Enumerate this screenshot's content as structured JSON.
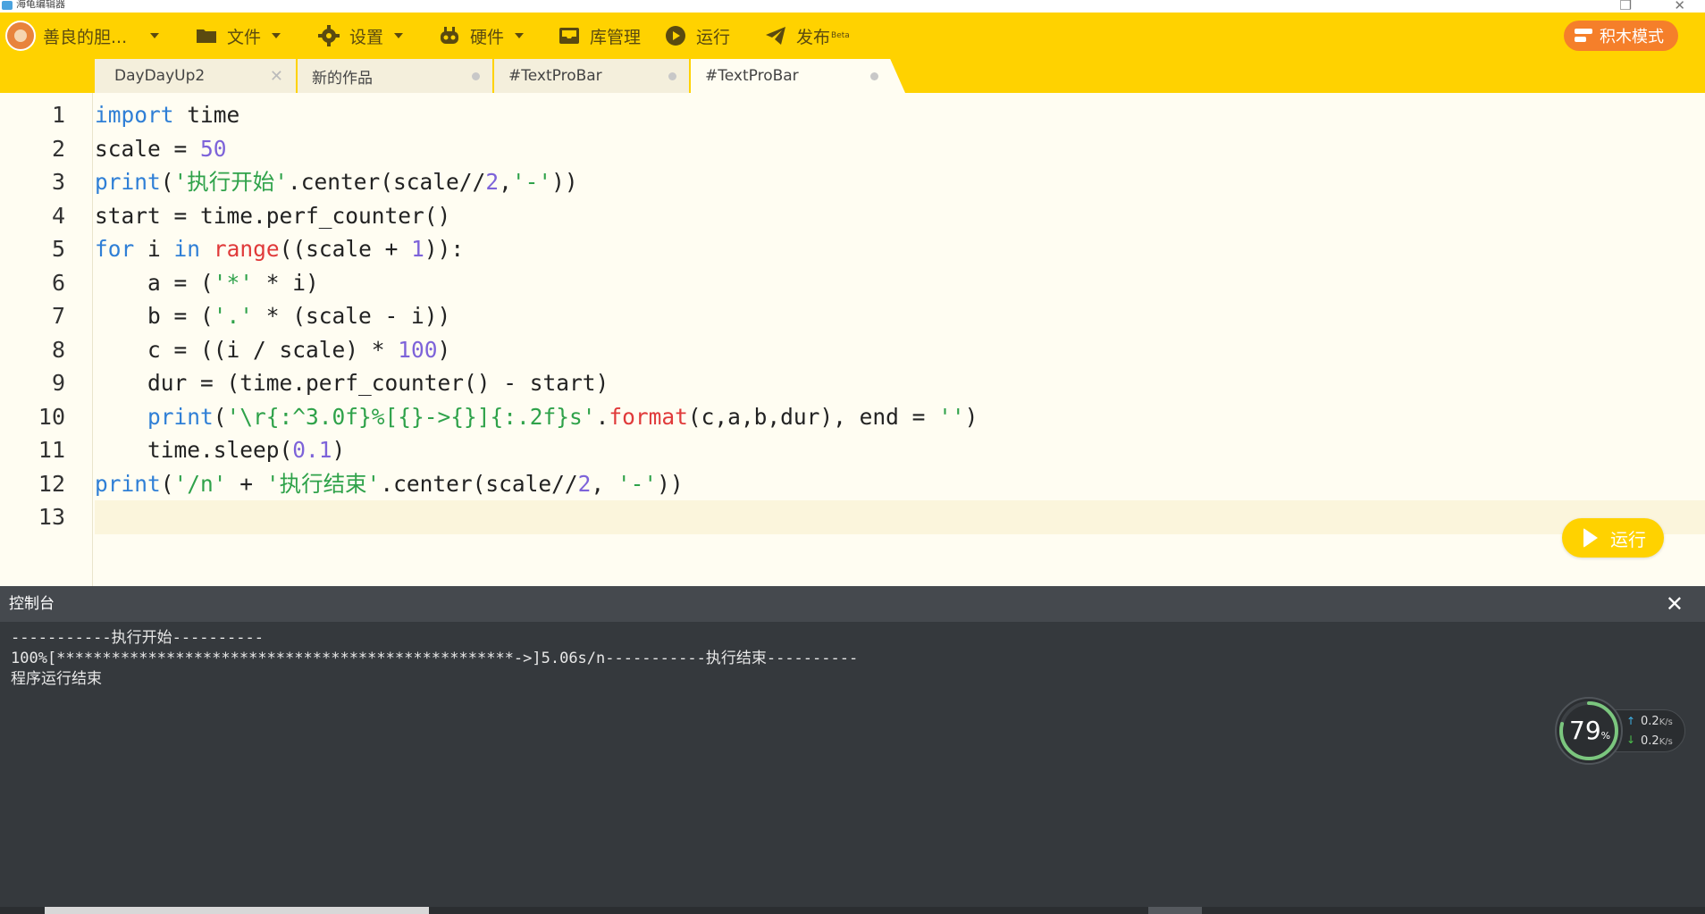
{
  "window": {
    "title": "海龟编辑器",
    "close_glyph": "✕",
    "restore_glyph": "❐"
  },
  "menubar": {
    "user_name": "善良的胆...",
    "file": "文件",
    "settings": "设置",
    "hardware": "硬件",
    "library": "库管理",
    "run": "运行",
    "publish": "发布",
    "publish_badge": "Beta",
    "block_mode": "积木模式"
  },
  "tabs": [
    {
      "label": "DayDayUp2",
      "close": "✕"
    },
    {
      "label": "新的作品"
    },
    {
      "label": "#TextProBar"
    },
    {
      "label": "#TextProBar"
    }
  ],
  "editor": {
    "line_numbers": [
      "1",
      "2",
      "3",
      "4",
      "5",
      "6",
      "7",
      "8",
      "9",
      "10",
      "11",
      "12",
      "13"
    ],
    "run_button": "运行"
  },
  "console": {
    "title": "控制台",
    "close_glyph": "✕",
    "lines": [
      "-----------执行开始----------",
      "100%[**************************************************->]5.06s/n-----------执行结束----------",
      "程序运行结束"
    ]
  },
  "net_monitor": {
    "percent": "79",
    "percent_unit": "%",
    "up_rate": "0.2",
    "down_rate": "0.2",
    "rate_unit": "K/s"
  },
  "colors": {
    "menubar_bg": "#ffd200",
    "block_mode_btn": "#f57f2a",
    "keyword": "#2f7fd6",
    "builtin": "#e03a3a",
    "number": "#7d63d9",
    "string": "#2fa24a"
  }
}
